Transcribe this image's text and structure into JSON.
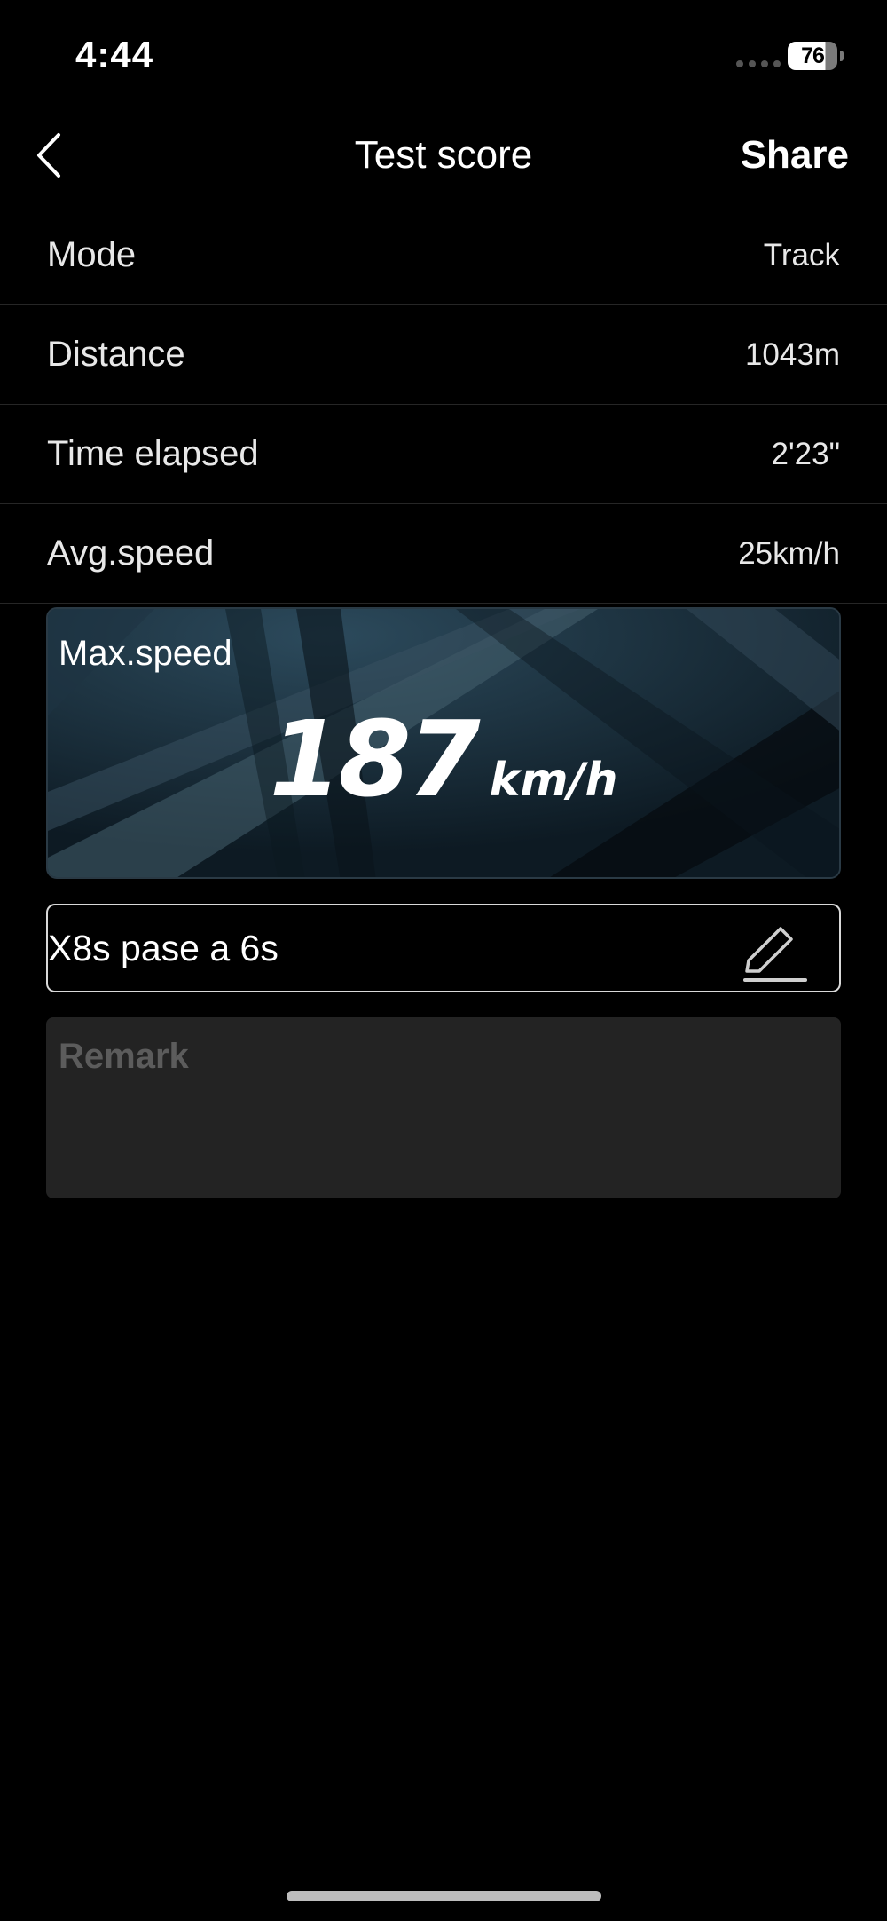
{
  "status_bar": {
    "time": "4:44",
    "battery": "76"
  },
  "nav": {
    "title": "Test score",
    "share_label": "Share",
    "back_icon": "chevron-left-icon"
  },
  "stats": [
    {
      "label": "Mode",
      "value": "Track"
    },
    {
      "label": "Distance",
      "value": "1043m"
    },
    {
      "label": "Time elapsed",
      "value": "2'23\""
    },
    {
      "label": "Avg.speed",
      "value": "25km/h"
    }
  ],
  "max_speed": {
    "label": "Max.speed",
    "value": "187",
    "unit": "km/h"
  },
  "test_name": {
    "value": "X8s pase a 6s",
    "edit_icon": "pencil-icon"
  },
  "remark": {
    "placeholder": "Remark"
  },
  "colors": {
    "background": "#000000",
    "card_bg": "#12212c",
    "remark_bg": "#232323",
    "divider": "#262626"
  }
}
